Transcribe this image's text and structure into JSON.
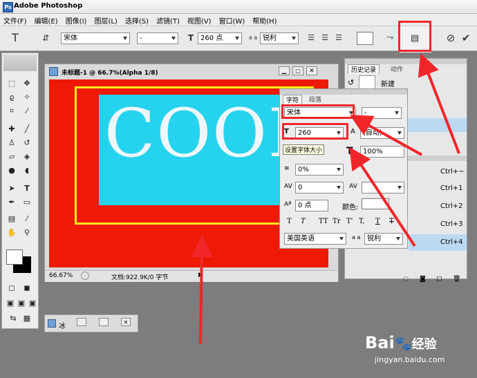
{
  "app": {
    "title": "Adobe Photoshop"
  },
  "menu": [
    "文件(F)",
    "编辑(E)",
    "图像(I)",
    "图层(L)",
    "选择(S)",
    "滤镜(T)",
    "视图(V)",
    "窗口(W)",
    "帮助(H)"
  ],
  "options": {
    "font_family": "宋体",
    "font_style": "-",
    "font_size": "260 点",
    "aa_label": "a a",
    "antialias": "锐利"
  },
  "document": {
    "title": "未标题-1 @ 66.7%(Alpha 1/8)",
    "zoom": "66.67%",
    "doc_info": "文档:922.9K/0 字节",
    "canvas_text": "COOL"
  },
  "history_panel": {
    "tab_history": "历史记录",
    "tab_actions": "动作",
    "item_new": "新建",
    "shortcuts": [
      "Ctrl+~",
      "Ctrl+1",
      "Ctrl+2",
      "Ctrl+3",
      "Ctrl+4"
    ]
  },
  "char_panel": {
    "tab_character": "字符",
    "tab_paragraph": "段落",
    "font_family": "宋体",
    "font_style": "-",
    "size": "260",
    "leading": "(自动)",
    "tooltip": "设置字体大小",
    "vscale": "100%",
    "tracking_pct": "0%",
    "kerning": "0",
    "baseline": "0 点",
    "color_label": "颜色:",
    "language": "美国英语",
    "aa_label": "a a",
    "antialias": "锐利",
    "style_buttons": [
      "T",
      "T",
      "TT",
      "Tr",
      "T'",
      "T,",
      "T",
      "T"
    ]
  },
  "mini_panel": {
    "label": "冰"
  },
  "watermark": {
    "brand": "Bai",
    "brand2": "经验",
    "url": "jingyan.baidu.com"
  },
  "colors": {
    "canvas_red": "#ee1a06",
    "cyan": "#26d3ee",
    "highlight_yellow": "#f5f018",
    "annotation_red": "#f1262b"
  }
}
